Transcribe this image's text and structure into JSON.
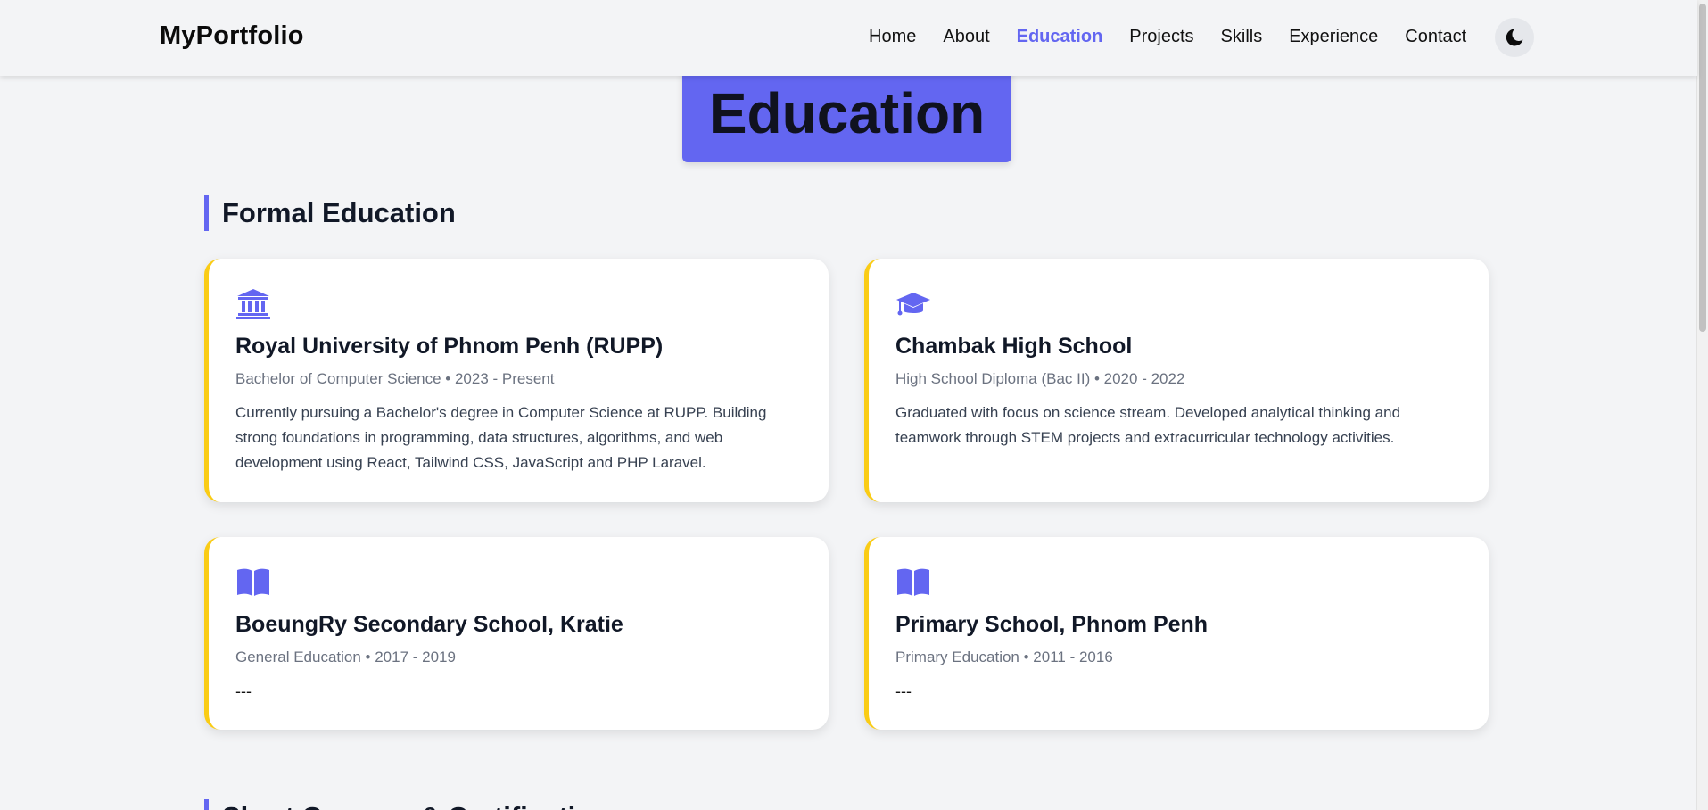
{
  "nav": {
    "brand": "MyPortfolio",
    "links": [
      "Home",
      "About",
      "Education",
      "Projects",
      "Skills",
      "Experience",
      "Contact"
    ],
    "active": "Education",
    "theme_toggle_icon": "moon-icon"
  },
  "page_title": "Education",
  "sections": {
    "formal": {
      "heading": "Formal Education"
    },
    "next": {
      "heading": "Short Courses & Certifications"
    }
  },
  "education": [
    {
      "icon": "university-icon",
      "name": "Royal University of Phnom Penh (RUPP)",
      "meta": "Bachelor of Computer Science • 2023 - Present",
      "description": "Currently pursuing a Bachelor's degree in Computer Science at RUPP. Building strong foundations in programming, data structures, algorithms, and web development using React, Tailwind CSS, JavaScript and PHP Laravel."
    },
    {
      "icon": "graduation-cap-icon",
      "name": "Chambak High School",
      "meta": "High School Diploma (Bac II) • 2020 - 2022",
      "description": "Graduated with focus on science stream. Developed analytical thinking and teamwork through STEM projects and extracurricular technology activities."
    },
    {
      "icon": "book-icon",
      "name": "BoeungRy Secondary School, Kratie",
      "meta": "General Education • 2017 - 2019",
      "description": "---"
    },
    {
      "icon": "book-icon",
      "name": "Primary School, Phnom Penh",
      "meta": "Primary Education • 2011 - 2016",
      "description": "---"
    }
  ],
  "colors": {
    "accent": "#6366f1",
    "card_border": "#facc15",
    "background": "#f3f4f6"
  }
}
